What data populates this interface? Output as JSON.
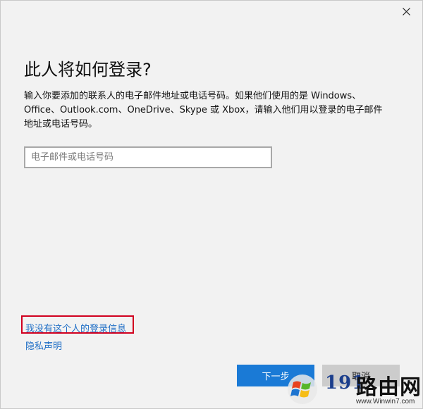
{
  "dialog": {
    "title": "此人将如何登录?",
    "description": "输入你要添加的联系人的电子邮件地址或电话号码。如果他们使用的是 Windows、Office、Outlook.com、OneDrive、Skype 或 Xbox，请输入他们用以登录的电子邮件地址或电话号码。",
    "email_input": {
      "value": "",
      "placeholder": "电子邮件或电话号码"
    },
    "no_signin_info_link": "我没有这个人的登录信息",
    "privacy_link": "隐私声明",
    "next_button": "下一步",
    "cancel_button": "取消",
    "close_icon": "close-icon"
  },
  "watermark": {
    "logo_icon": "windows-logo-icon",
    "number": "191",
    "brand": "路由网",
    "url": "www.Winwin7.com"
  },
  "colors": {
    "background": "#f2f2f2",
    "accent": "#1a7ad6",
    "link": "#1f6ec6",
    "highlight": "#d1001f"
  }
}
